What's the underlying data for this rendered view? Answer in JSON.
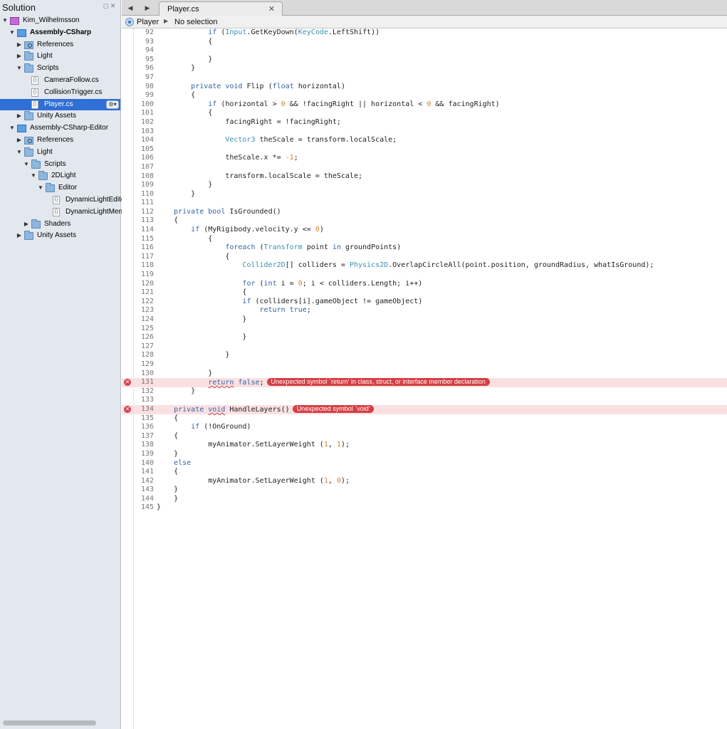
{
  "solution": {
    "title": "Solution",
    "tree": [
      {
        "depth": 0,
        "icon": "solution-icon",
        "label": "Kim_Wilhelmsson",
        "expanded": true,
        "bold": false
      },
      {
        "depth": 1,
        "icon": "project-icon",
        "label": "Assembly-CSharp",
        "expanded": true,
        "bold": true
      },
      {
        "depth": 2,
        "icon": "references-icon",
        "label": "References",
        "expanded": false,
        "bold": false
      },
      {
        "depth": 2,
        "icon": "folder-icon",
        "label": "Light",
        "expanded": false,
        "bold": false
      },
      {
        "depth": 2,
        "icon": "folder-icon",
        "label": "Scripts",
        "expanded": true,
        "bold": false
      },
      {
        "depth": 3,
        "icon": "file-icon",
        "label": "CameraFollow.cs",
        "bold": false
      },
      {
        "depth": 3,
        "icon": "file-icon",
        "label": "CollisionTrigger.cs",
        "bold": false
      },
      {
        "depth": 3,
        "icon": "file-icon",
        "label": "Player.cs",
        "bold": false,
        "selected": true
      },
      {
        "depth": 2,
        "icon": "folder-icon",
        "label": "Unity Assets",
        "expanded": false,
        "bold": false
      },
      {
        "depth": 1,
        "icon": "project-icon",
        "label": "Assembly-CSharp-Editor",
        "expanded": true,
        "bold": false
      },
      {
        "depth": 2,
        "icon": "references-icon",
        "label": "References",
        "expanded": false,
        "bold": false
      },
      {
        "depth": 2,
        "icon": "folder-icon",
        "label": "Light",
        "expanded": true,
        "bold": false
      },
      {
        "depth": 3,
        "icon": "folder-icon",
        "label": "Scripts",
        "expanded": true,
        "bold": false
      },
      {
        "depth": 4,
        "icon": "folder-icon",
        "label": "2DLight",
        "expanded": true,
        "bold": false
      },
      {
        "depth": 5,
        "icon": "folder-icon",
        "label": "Editor",
        "expanded": true,
        "bold": false
      },
      {
        "depth": 6,
        "icon": "file-icon",
        "label": "DynamicLightEditor.cs",
        "bold": false
      },
      {
        "depth": 6,
        "icon": "file-icon",
        "label": "DynamicLightMenu.cs",
        "bold": false
      },
      {
        "depth": 3,
        "icon": "folder-icon",
        "label": "Shaders",
        "expanded": false,
        "bold": false
      },
      {
        "depth": 2,
        "icon": "folder-icon",
        "label": "Unity Assets",
        "expanded": false,
        "bold": false
      }
    ]
  },
  "tabs": {
    "active_label": "Player.cs",
    "back_icon": "chevron-left-icon",
    "forward_icon": "chevron-right-icon",
    "close_icon": "close-icon"
  },
  "breadcrumb": {
    "class_name": "Player",
    "member": "No selection"
  },
  "colors": {
    "keyword": "#3364a4",
    "type": "#3b8fb3",
    "number": "#d9822b",
    "error": "#d63f45",
    "error_line": "#fbe0e1",
    "selection": "#2f6fd6"
  },
  "code_lines": [
    {
      "n": "92",
      "t": "            if (Input.GetKeyDown(KeyCode.LeftShift))"
    },
    {
      "n": "93",
      "t": "            {"
    },
    {
      "n": "94",
      "t": ""
    },
    {
      "n": "95",
      "t": "            }"
    },
    {
      "n": "96",
      "t": "        }"
    },
    {
      "n": "97",
      "t": ""
    },
    {
      "n": "98",
      "t": "        private void Flip (float horizontal)"
    },
    {
      "n": "99",
      "t": "        {"
    },
    {
      "n": "100",
      "t": "            if (horizontal > 0 && !facingRight || horizontal < 0 && facingRight)"
    },
    {
      "n": "101",
      "t": "            {"
    },
    {
      "n": "102",
      "t": "                facingRight = !facingRight;"
    },
    {
      "n": "103",
      "t": ""
    },
    {
      "n": "104",
      "t": "                Vector3 theScale = transform.localScale;"
    },
    {
      "n": "105",
      "t": ""
    },
    {
      "n": "106",
      "t": "                theScale.x *= -1;"
    },
    {
      "n": "107",
      "t": ""
    },
    {
      "n": "108",
      "t": "                transform.localScale = theScale;"
    },
    {
      "n": "109",
      "t": "            }"
    },
    {
      "n": "110",
      "t": "        }"
    },
    {
      "n": "111",
      "t": ""
    },
    {
      "n": "112",
      "t": "    private bool IsGrounded()"
    },
    {
      "n": "113",
      "t": "    {"
    },
    {
      "n": "114",
      "t": "        if (MyRigibody.velocity.y <= 0)"
    },
    {
      "n": "115",
      "t": "            {"
    },
    {
      "n": "116",
      "t": "                foreach (Transform point in groundPoints)"
    },
    {
      "n": "117",
      "t": "                {"
    },
    {
      "n": "118",
      "t": "                    Collider2D[] colliders = Physics2D.OverlapCircleAll(point.position, groundRadius, whatIsGround);"
    },
    {
      "n": "119",
      "t": ""
    },
    {
      "n": "120",
      "t": "                    for (int i = 0; i < colliders.Length; i++)"
    },
    {
      "n": "121",
      "t": "                    {"
    },
    {
      "n": "122",
      "t": "                    if (colliders[i].gameObject != gameObject)"
    },
    {
      "n": "123",
      "t": "                        return true;"
    },
    {
      "n": "124",
      "t": "                    }"
    },
    {
      "n": "125",
      "t": ""
    },
    {
      "n": "126",
      "t": "                    }"
    },
    {
      "n": "127",
      "t": ""
    },
    {
      "n": "128",
      "t": "                }"
    },
    {
      "n": "129",
      "t": ""
    },
    {
      "n": "130",
      "t": "            }"
    },
    {
      "n": "131",
      "t": "            return false;",
      "error": "Unexpected symbol `return' in class, struct, or interface member declaration"
    },
    {
      "n": "132",
      "t": "        }"
    },
    {
      "n": "133",
      "t": ""
    },
    {
      "n": "134",
      "t": "    private void HandleLayers()",
      "error": "Unexpected symbol `void'"
    },
    {
      "n": "135",
      "t": "    {"
    },
    {
      "n": "136",
      "t": "        if (!OnGround)"
    },
    {
      "n": "137",
      "t": "    {"
    },
    {
      "n": "138",
      "t": "            myAnimator.SetLayerWeight (1, 1);"
    },
    {
      "n": "139",
      "t": "    }"
    },
    {
      "n": "140",
      "t": "    else"
    },
    {
      "n": "141",
      "t": "    {"
    },
    {
      "n": "142",
      "t": "            myAnimator.SetLayerWeight (1, 0);"
    },
    {
      "n": "143",
      "t": "    }"
    },
    {
      "n": "144",
      "t": "    }"
    },
    {
      "n": "145",
      "t": "}"
    }
  ]
}
